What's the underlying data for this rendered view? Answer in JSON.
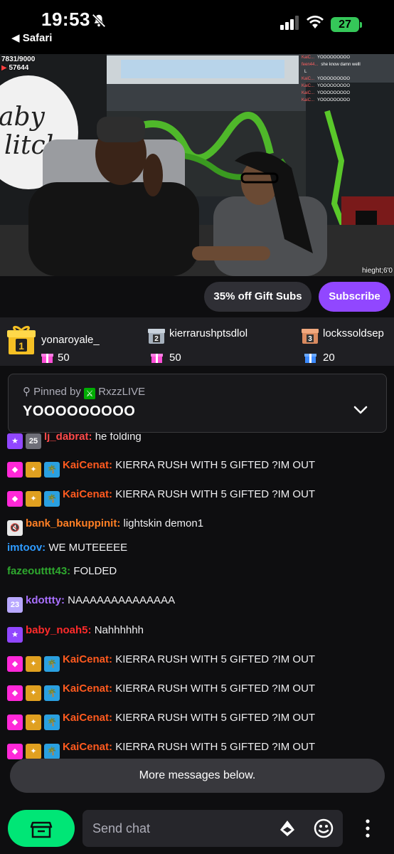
{
  "status_bar": {
    "time": "19:53",
    "back_label": "◀ Safari",
    "battery": "27"
  },
  "stream_overlay": {
    "viewer_goal": "7831/9000",
    "youtube_count": "57644",
    "height_tag": "hieght;6'0",
    "chat_lines": [
      {
        "user": "KaiC...",
        "text": "YOOOOOOOOO"
      },
      {
        "user": "feen44...",
        "text": "she know damn welll"
      },
      {
        "user": "",
        "text": "L"
      },
      {
        "user": "KaiC...",
        "text": "YOOOOOOOOO"
      },
      {
        "user": "KaiC...",
        "text": "YOOOOOOOOO"
      },
      {
        "user": "KaiC...",
        "text": "YOOOOOOOOO"
      },
      {
        "user": "KaiC...",
        "text": "YOOOOOOOOO"
      }
    ]
  },
  "actions": {
    "gift_subs": "35% off Gift Subs",
    "subscribe": "Subscribe"
  },
  "leaderboard": [
    {
      "rank": "1",
      "name": "yonaroyale_",
      "count": "50"
    },
    {
      "rank": "2",
      "name": "kierrarushptsdlol",
      "count": "50"
    },
    {
      "rank": "3",
      "name": "lockssoldsep",
      "count": "20"
    }
  ],
  "pinned": {
    "label": "Pinned by",
    "by_user": "RxzzLIVE",
    "text": "YOOOOOOOOO"
  },
  "messages": [
    {
      "user": "lj_dabrat",
      "color": "#ff4a4a",
      "text": "he folding",
      "badges": [
        "sub-star",
        "25"
      ]
    },
    {
      "user": "KaiCenat",
      "color": "#ff5a1f",
      "text": "KIERRA RUSH WITH 5 GIFTED ?IM OUT",
      "badges": [
        "diamond",
        "gold",
        "palm"
      ]
    },
    {
      "user": "KaiCenat",
      "color": "#ff5a1f",
      "text": "KIERRA RUSH WITH 5 GIFTED ?IM OUT",
      "badges": [
        "diamond",
        "gold",
        "palm"
      ]
    },
    {
      "user": "bank_bankuppinit",
      "color": "#ff7f24",
      "text": "lightskin demon1",
      "badges": [
        "mute"
      ]
    },
    {
      "user": "imtoov",
      "color": "#2e9bff",
      "text": "WE MUTEEEEE",
      "badges": []
    },
    {
      "user": "fazeoutttt43",
      "color": "#2ea82e",
      "text": "FOLDED",
      "badges": []
    },
    {
      "user": "kdottty",
      "color": "#a970ff",
      "text": "NAAAAAAAAAAAAAA",
      "badges": [
        "2023"
      ]
    },
    {
      "user": "baby_noah5",
      "color": "#ff2b2b",
      "text": "Nahhhhhh",
      "badges": [
        "sub-star"
      ]
    },
    {
      "user": "KaiCenat",
      "color": "#ff5a1f",
      "text": "KIERRA RUSH WITH 5 GIFTED ?IM OUT",
      "badges": [
        "diamond",
        "gold",
        "palm"
      ]
    },
    {
      "user": "KaiCenat",
      "color": "#ff5a1f",
      "text": "KIERRA RUSH WITH 5 GIFTED ?IM OUT",
      "badges": [
        "diamond",
        "gold",
        "palm"
      ]
    },
    {
      "user": "KaiCenat",
      "color": "#ff5a1f",
      "text": "KIERRA RUSH WITH 5 GIFTED ?IM OUT",
      "badges": [
        "diamond",
        "gold",
        "palm"
      ]
    },
    {
      "user": "KaiCenat",
      "color": "#ff5a1f",
      "text": "KIERRA RUSH WITH 5 GIFTED ?IM OUT",
      "badges": [
        "diamond",
        "gold",
        "palm"
      ]
    }
  ],
  "more_messages": "More messages below.",
  "input": {
    "placeholder": "Send chat"
  },
  "colors": {
    "accent": "#9147ff",
    "store": "#00e676"
  }
}
